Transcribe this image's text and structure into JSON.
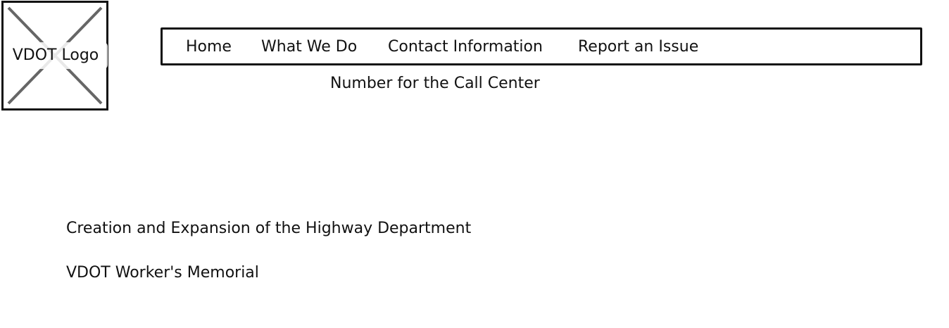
{
  "logo": {
    "label": "VDOT Logo",
    "icon": "image-placeholder-icon"
  },
  "nav": {
    "items": [
      {
        "label": "Home"
      },
      {
        "label": "What We Do"
      },
      {
        "label": "Contact Information"
      },
      {
        "label": "Report an Issue"
      }
    ]
  },
  "header": {
    "callcenter_text": "Number for the Call Center"
  },
  "main": {
    "links": [
      {
        "label": "Creation and Expansion of the Highway Department"
      },
      {
        "label": "VDOT Worker's Memorial"
      }
    ]
  },
  "colors": {
    "stroke": "#111111",
    "placeholder_x": "#666666",
    "background": "#ffffff"
  }
}
